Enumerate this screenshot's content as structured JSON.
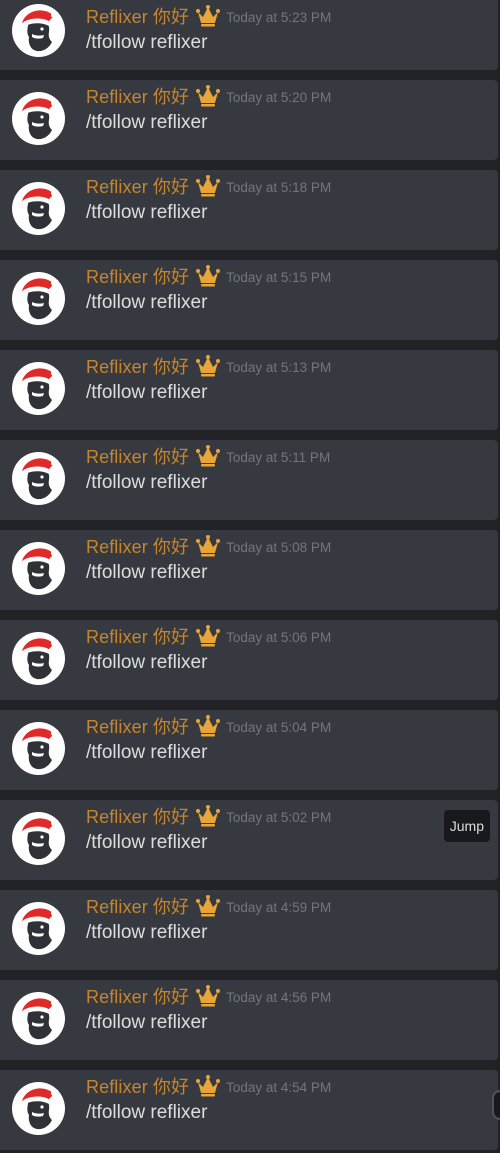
{
  "colors": {
    "username": "#c9852a",
    "timestamp": "#72767d",
    "message_text": "#dcddde",
    "message_bg": "#36393f",
    "separator_bg": "#202225",
    "crown": "#e8a53a"
  },
  "jump_label": "Jump",
  "messages": [
    {
      "username": "Reflixer 你好",
      "badge_icon": "crown-icon",
      "timestamp": "Today at 5:23 PM",
      "content": "/tfollow reflixer"
    },
    {
      "username": "Reflixer 你好",
      "badge_icon": "crown-icon",
      "timestamp": "Today at 5:20 PM",
      "content": "/tfollow reflixer"
    },
    {
      "username": "Reflixer 你好",
      "badge_icon": "crown-icon",
      "timestamp": "Today at 5:18 PM",
      "content": "/tfollow reflixer"
    },
    {
      "username": "Reflixer 你好",
      "badge_icon": "crown-icon",
      "timestamp": "Today at 5:15 PM",
      "content": "/tfollow reflixer"
    },
    {
      "username": "Reflixer 你好",
      "badge_icon": "crown-icon",
      "timestamp": "Today at 5:13 PM",
      "content": "/tfollow reflixer"
    },
    {
      "username": "Reflixer 你好",
      "badge_icon": "crown-icon",
      "timestamp": "Today at 5:11 PM",
      "content": "/tfollow reflixer"
    },
    {
      "username": "Reflixer 你好",
      "badge_icon": "crown-icon",
      "timestamp": "Today at 5:08 PM",
      "content": "/tfollow reflixer"
    },
    {
      "username": "Reflixer 你好",
      "badge_icon": "crown-icon",
      "timestamp": "Today at 5:06 PM",
      "content": "/tfollow reflixer"
    },
    {
      "username": "Reflixer 你好",
      "badge_icon": "crown-icon",
      "timestamp": "Today at 5:04 PM",
      "content": "/tfollow reflixer"
    },
    {
      "username": "Reflixer 你好",
      "badge_icon": "crown-icon",
      "timestamp": "Today at 5:02 PM",
      "content": "/tfollow reflixer"
    },
    {
      "username": "Reflixer 你好",
      "badge_icon": "crown-icon",
      "timestamp": "Today at 4:59 PM",
      "content": "/tfollow reflixer"
    },
    {
      "username": "Reflixer 你好",
      "badge_icon": "crown-icon",
      "timestamp": "Today at 4:56 PM",
      "content": "/tfollow reflixer"
    },
    {
      "username": "Reflixer 你好",
      "badge_icon": "crown-icon",
      "timestamp": "Today at 4:54 PM",
      "content": "/tfollow reflixer"
    }
  ]
}
